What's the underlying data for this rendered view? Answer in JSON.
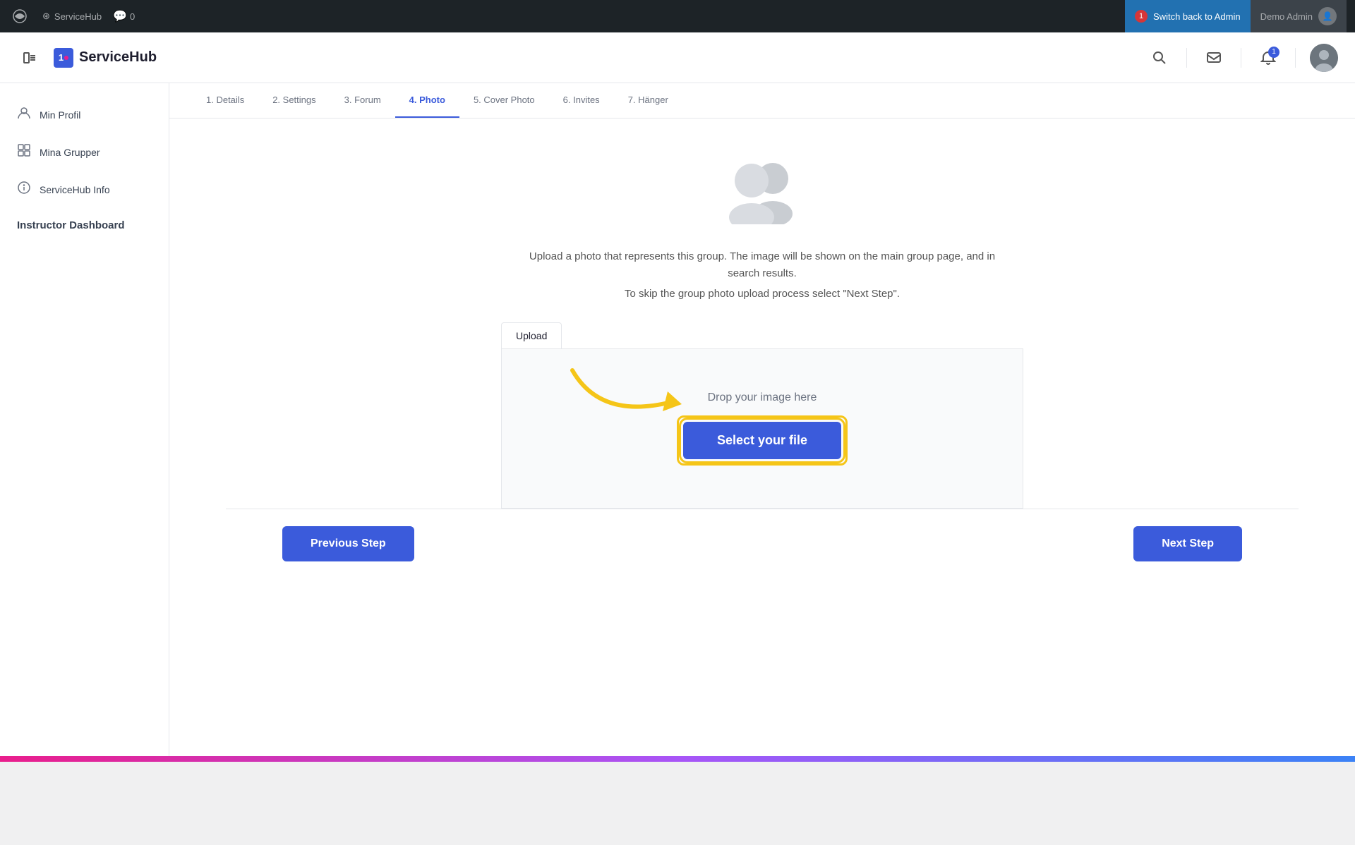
{
  "admin_bar": {
    "wp_icon": "⊞",
    "site_name": "ServiceHub",
    "comments_label": "0",
    "switch_admin_badge": "1",
    "switch_admin_label": "Switch back to Admin",
    "demo_admin_label": "Demo Admin"
  },
  "header": {
    "brand_name": "ServiceHub",
    "brand_initial": "1"
  },
  "sidebar": {
    "items": [
      {
        "label": "Min Profil",
        "icon": "👤"
      },
      {
        "label": "Mina Grupper",
        "icon": "⊞"
      },
      {
        "label": "ServiceHub Info",
        "icon": "ℹ"
      }
    ],
    "instructor_label": "Instructor Dashboard"
  },
  "steps": {
    "tabs": [
      {
        "label": "1. Details",
        "active": false
      },
      {
        "label": "2. Settings",
        "active": false
      },
      {
        "label": "3. Forum",
        "active": false
      },
      {
        "label": "4. Photo",
        "active": true
      },
      {
        "label": "5. Cover Photo",
        "active": false
      },
      {
        "label": "6. Invites",
        "active": false
      },
      {
        "label": "7. Hänger",
        "active": false
      }
    ]
  },
  "photo": {
    "description": "Upload a photo that represents this group. The image will be shown on the main group page, and in search results.",
    "skip_text": "To skip the group photo upload process select \"Next Step\".",
    "upload_tab_label": "Upload",
    "drop_text": "Drop your image here",
    "select_file_label": "Select your file"
  },
  "navigation": {
    "prev_label": "Previous Step",
    "next_label": "Next Step"
  }
}
